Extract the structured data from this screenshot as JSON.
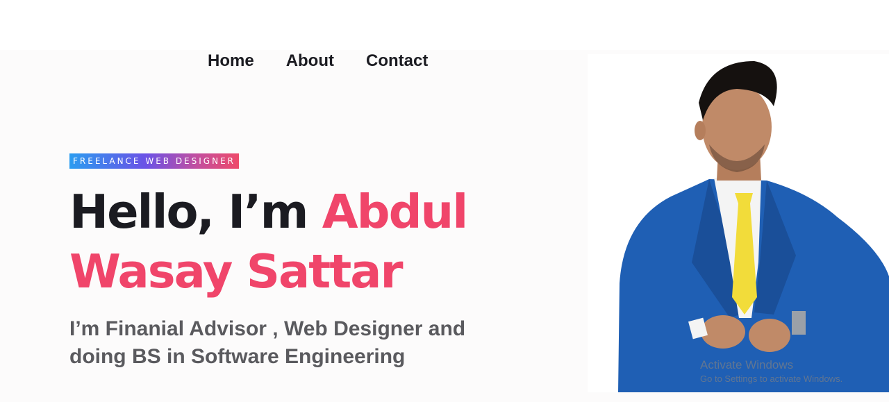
{
  "nav": {
    "items": [
      {
        "label": "Home"
      },
      {
        "label": "About"
      },
      {
        "label": "Contact"
      }
    ]
  },
  "hero": {
    "badge": "FREELANCE WEB DESIGNER",
    "greeting": "Hello, I’m ",
    "name_line1": "Abdul",
    "name_line2": "Wasay Sattar",
    "subtitle_line1": "I’m Finanial Advisor , Web Designer and",
    "subtitle_line2": "doing BS in Software Engineering"
  },
  "photo": {
    "subject": "man in blue suit with yellow tie"
  },
  "watermark": {
    "title": "Activate Windows",
    "subtitle": "Go to Settings to activate Windows."
  },
  "colors": {
    "accent": "#f0456a",
    "text_dark": "#1b1b21",
    "text_gray": "#5a5a5e",
    "suit_blue": "#1f5fb4",
    "tie_yellow": "#f2dc3a"
  }
}
